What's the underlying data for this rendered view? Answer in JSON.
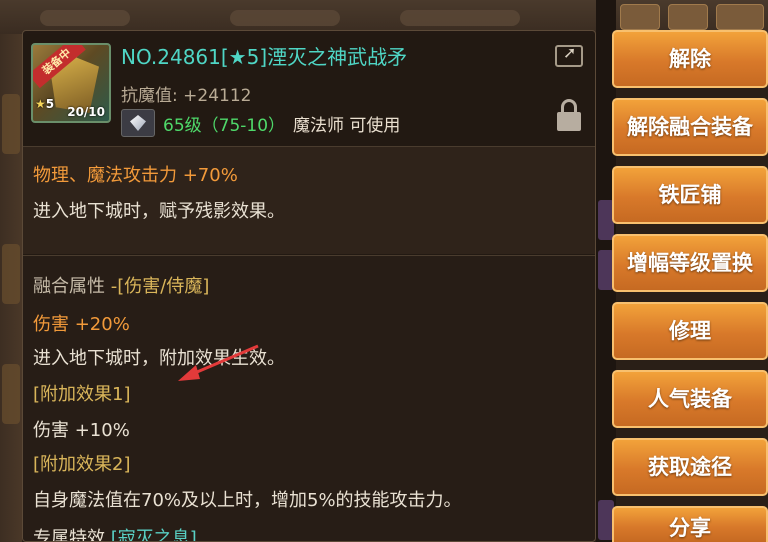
{
  "item": {
    "title": "NO.24861[★5]湮灭之神武战矛",
    "equipped_badge": "装备中",
    "star_count": "5",
    "icon_level": "20/10",
    "resist_label": "抗魔值:",
    "resist_value": "+24112",
    "level_range": "65级（75-10）",
    "class_req": "魔法师 可使用"
  },
  "stats": {
    "line1": "物理、魔法攻击力 +70%",
    "line2": "进入地下城时，赋予残影效果。"
  },
  "fusion": {
    "header_label": "融合属性",
    "header_value": "-[伤害/侍魔]",
    "damage": "伤害 +20%",
    "damage_desc": "进入地下城时，附加效果生效。",
    "extra1_label": "[附加效果1]",
    "extra1_value": "伤害 +10%",
    "extra2_label": "[附加效果2]",
    "extra2_value": "自身魔法值在70%及以上时，增加5%的技能攻击力。",
    "exclusive_label": "专属特效",
    "exclusive_value": "[寂灭之息]"
  },
  "menu": {
    "items": [
      "解除",
      "解除融合装备",
      "铁匠铺",
      "增幅等级置换",
      "修理",
      "人气装备",
      "获取途径",
      "分享"
    ]
  },
  "colors": {
    "title": "#4fd6c5",
    "stat_orange": "#f29a3a",
    "level_green": "#4fd96a",
    "menu_orange": "#e08a2e",
    "arrow_red": "#e23a3a"
  },
  "icons": [
    "share-icon",
    "lock-icon",
    "gem-icon"
  ]
}
